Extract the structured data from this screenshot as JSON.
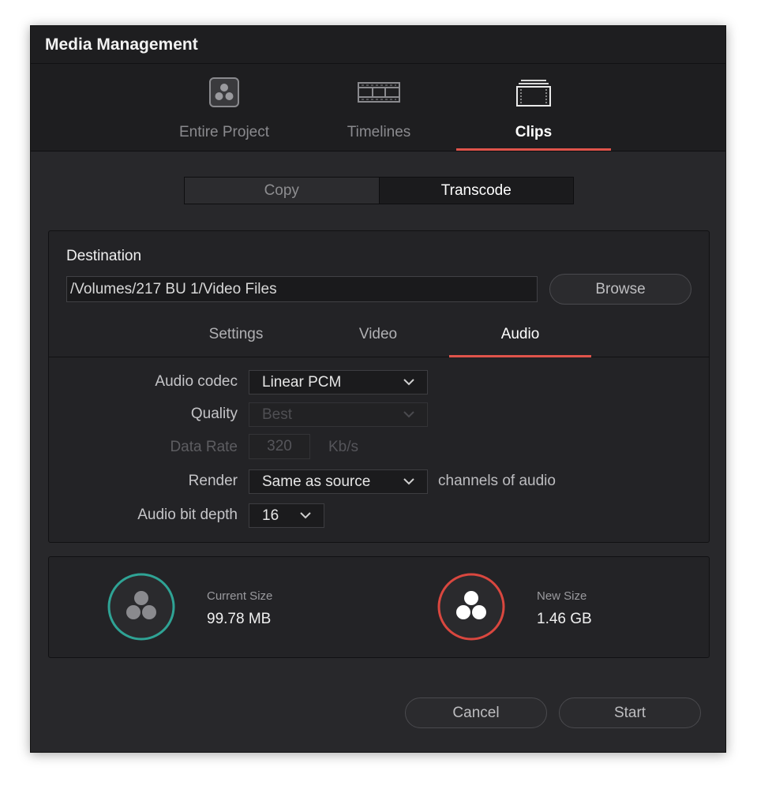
{
  "window": {
    "title": "Media Management"
  },
  "top_tabs": [
    {
      "label": "Entire Project",
      "icon": "resolve-project-icon"
    },
    {
      "label": "Timelines",
      "icon": "timelines-icon"
    },
    {
      "label": "Clips",
      "icon": "clips-icon"
    }
  ],
  "top_tabs_active": "Clips",
  "mode": {
    "copy_label": "Copy",
    "transcode_label": "Transcode",
    "selected": "Transcode"
  },
  "destination": {
    "label": "Destination",
    "path": "/Volumes/217 BU 1/Video Files",
    "browse_label": "Browse"
  },
  "sub_tabs": [
    {
      "label": "Settings"
    },
    {
      "label": "Video"
    },
    {
      "label": "Audio"
    }
  ],
  "sub_tabs_active": "Audio",
  "audio": {
    "codec_label": "Audio codec",
    "codec_value": "Linear PCM",
    "quality_label": "Quality",
    "quality_value": "Best",
    "data_rate_label": "Data Rate",
    "data_rate_value": "320",
    "data_rate_unit": "Kb/s",
    "render_label": "Render",
    "render_value": "Same as source",
    "render_suffix": "channels of audio",
    "bit_depth_label": "Audio bit depth",
    "bit_depth_value": "16"
  },
  "sizes": {
    "current_label": "Current Size",
    "current_value": "99.78 MB",
    "current_ring_color": "#2fa395",
    "new_label": "New Size",
    "new_value": "1.46 GB",
    "new_ring_color": "#d9473f"
  },
  "footer": {
    "cancel_label": "Cancel",
    "start_label": "Start"
  },
  "colors": {
    "accent": "#e0544b",
    "background": "#28282b"
  }
}
